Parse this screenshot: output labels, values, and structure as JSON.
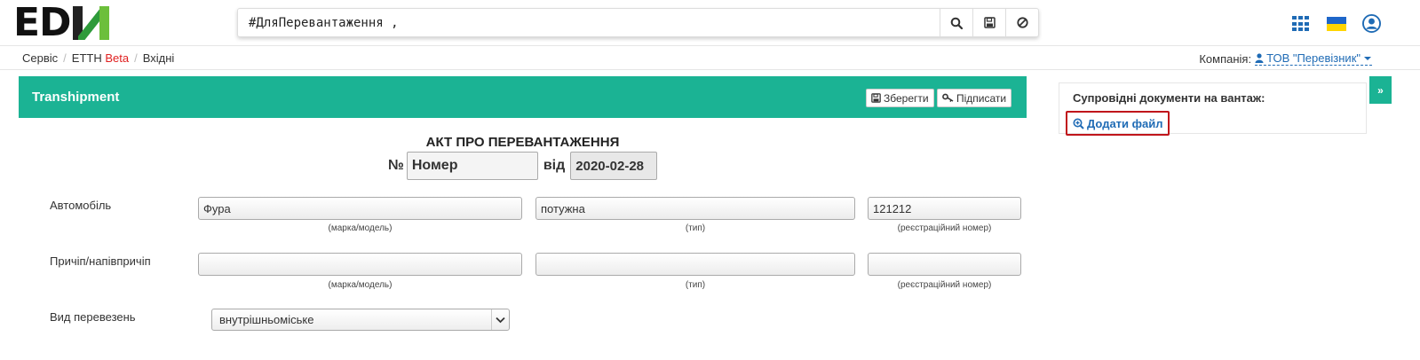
{
  "header": {
    "logo_text": "EDIN",
    "search": {
      "value": "#ДляПеревантаження ,"
    },
    "icons": [
      "search-icon",
      "save-icon",
      "clear-icon",
      "apps-icon",
      "ukraine-flag-icon",
      "user-icon"
    ]
  },
  "breadcrumb": {
    "items": [
      "Сервіс",
      "ЕТТН",
      "Вхідні"
    ],
    "beta": "Beta"
  },
  "company": {
    "label": "Компанія:",
    "value": "ТОВ \"Перевізник\""
  },
  "panel": {
    "title": "Transhipment",
    "save_label": "Зберегти",
    "sign_label": "Підписати",
    "doc_title": "АКТ ПРО ПЕРЕВАНТАЖЕННЯ",
    "number_prefix": "№",
    "number_placeholder": "Номер",
    "date_prefix": "від",
    "date_value": "2020-02-28"
  },
  "vehicle": {
    "label": "Автомобіль",
    "model": "Фура",
    "type": "потужна",
    "reg": "121212",
    "hint_model": "(марка/модель)",
    "hint_type": "(тип)",
    "hint_reg": "(реєстраційний номер)"
  },
  "trailer": {
    "label": "Причіп/напівпричіп",
    "model": "",
    "type": "",
    "reg": "",
    "hint_model": "(марка/модель)",
    "hint_type": "(тип)",
    "hint_reg": "(реєстраційний номер)"
  },
  "transport": {
    "label": "Вид перевезень",
    "selected": "внутрішньоміське"
  },
  "side": {
    "title": "Супровідні документи на вантаж:",
    "add_file_label": "Додати файл",
    "collapse_label": "»"
  },
  "colors": {
    "accent": "#1bb394",
    "link": "#1f6bb5",
    "highlight": "#c0151b",
    "beta": "#e02020"
  }
}
